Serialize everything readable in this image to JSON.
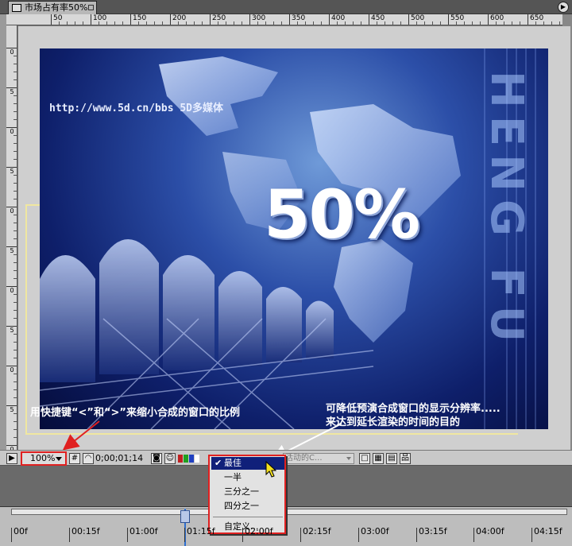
{
  "tab": {
    "title": "市场占有率50%"
  },
  "ruler_top": {
    "labels": [
      "50",
      "100",
      "150",
      "200",
      "250",
      "300",
      "350",
      "400",
      "450",
      "500",
      "550",
      "600",
      "650"
    ]
  },
  "ruler_left": {
    "labels": [
      "0",
      "5",
      "0",
      "5",
      "0",
      "5",
      "0",
      "5",
      "0",
      "5",
      "0",
      "5"
    ]
  },
  "composition": {
    "url_text": "http://www.5d.cn/bbs 5D多媒体",
    "big_text": "50%",
    "vertical_text": "HENG FU"
  },
  "annotations": {
    "left": "用快捷键“<”和“>”来缩小合成的窗口的比例",
    "right_line1": "可降低预演合成窗口的显示分辨率.....",
    "right_line2": "来达到延长渲染的时间的目的"
  },
  "toolbar": {
    "zoom_value": "100%",
    "timecode": "0;00;01;14",
    "view_select": "活动的C..."
  },
  "resolution_menu": {
    "items": [
      {
        "label": "最佳",
        "checked": true
      },
      {
        "label": "一半",
        "checked": false
      },
      {
        "label": "三分之一",
        "checked": false
      },
      {
        "label": "四分之一",
        "checked": false
      },
      {
        "label": "自定义...",
        "checked": false
      }
    ]
  },
  "timeline": {
    "labels": [
      "00f",
      "00:15f",
      "01:00f",
      "01:15f",
      "02:00f",
      "02:15f",
      "03:00f",
      "03:15f",
      "04:00f",
      "04:15f"
    ]
  },
  "colors": {
    "highlight": "#e02020",
    "menu_selected": "#10207a",
    "safe_frame": "#f0e7a0",
    "playhead": "#2d6fd0"
  }
}
